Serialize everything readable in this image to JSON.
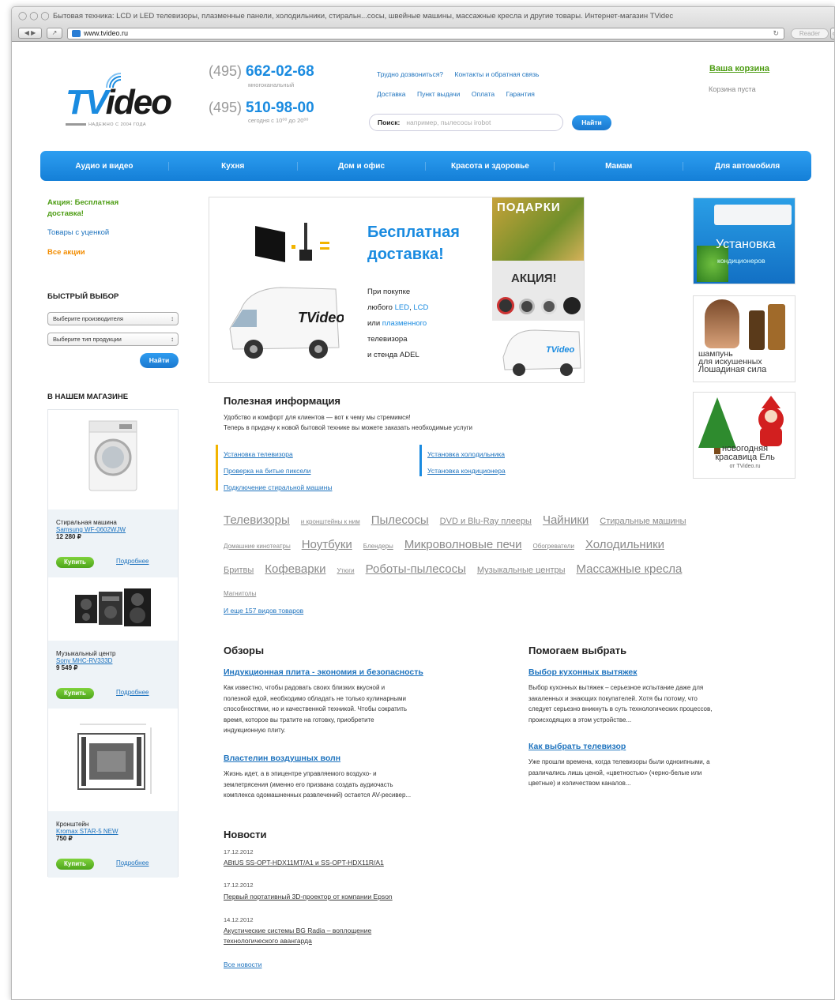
{
  "browser": {
    "window_title": "Бытовая техника: LCD и LED телевизоры, плазменные панели, холодильники, стиральн...сосы, швейные машины, массажные кресла и другие товары. Интернет-магазин TVidec",
    "url": "www.tvideo.ru",
    "reader_label": "Reader"
  },
  "header": {
    "logo_text_tv": "TV",
    "logo_text_ideo": "ideo",
    "logo_slogan": "НАДЕЖНО С 2004 ГОДА",
    "phone1_code": "(495)",
    "phone1_number": "662-02-68",
    "phone1_note": "многоканальный",
    "phone2_code": "(495)",
    "phone2_number": "510-98-00",
    "phone2_note": "сегодня с 10⁰⁰ до 20⁰⁰",
    "top_links_row1": [
      "Трудно дозвониться?",
      "Контакты и обратная связь"
    ],
    "top_links_row2": [
      "Доставка",
      "Пункт выдачи",
      "Оплата",
      "Гарантия"
    ],
    "search_label": "Поиск:",
    "search_placeholder": "например, пылесосы irobot",
    "search_button": "Найти",
    "cart_title": "Ваша корзина",
    "cart_status": "Корзина пуста"
  },
  "menu": [
    "Аудио и видео",
    "Кухня",
    "Дом и офис",
    "Красота и здоровье",
    "Мамам",
    "Для автомобиля"
  ],
  "left": {
    "promo_link": "Акция: Бесплатная доставка!",
    "discount_link": "Товары с уценкой",
    "all_promos_link": "Все акции",
    "quick_title": "БЫСТРЫЙ ВЫБОР",
    "select_maker": "Выберите производителя",
    "select_type": "Выберите тип продукции",
    "find_button": "Найти",
    "shop_title": "В НАШЕМ МАГАЗИНЕ",
    "products": [
      {
        "name": "Стиральная машина",
        "model": "Samsung WF-0602WJW",
        "price": "12 280 ₽",
        "buy": "Купить",
        "more": "Подробнее"
      },
      {
        "name": "Музыкальный центр",
        "model": "Sony MHC-RV333D",
        "price": "9 549 ₽",
        "buy": "Купить",
        "more": "Подробнее"
      },
      {
        "name": "Кронштейн",
        "model": "Kromax STAR-5 NEW",
        "price": "750 ₽",
        "buy": "Купить",
        "more": "Подробнее"
      }
    ]
  },
  "banner": {
    "title_line1": "Бесплатная",
    "title_line2": "доставка!",
    "desc": [
      "При покупке",
      "любого ",
      "LED",
      ", ",
      "LCD",
      "или ",
      "плазменного",
      "телевизора",
      "и стенда ADEL"
    ],
    "van_logo": "TVideo",
    "side_top": "ПОДАРКИ",
    "side_mid": "АКЦИЯ!",
    "van2_logo": "TVideo"
  },
  "useful": {
    "title": "Полезная информация",
    "text_line1": "Удобство и комфорт для клиентов — вот к чему мы стремимся!",
    "text_line2": "Теперь в придачу к новой бытовой технике вы можете заказать необходимые услуги",
    "links_left": [
      "Установка телевизора",
      "Проверка на битые пиксели",
      "Подключение стиральной машины"
    ],
    "links_right": [
      "Установка холодильника",
      "Установка кондиционера"
    ]
  },
  "tags": {
    "row1": [
      "Телевизоры",
      "и кронштейны к ним",
      "Пылесосы",
      "DVD и Blu-Ray плееры",
      "Чайники",
      "Стиральные машины"
    ],
    "row2": [
      "Домашние кинотеатры",
      "Ноутбуки",
      "Блендеры",
      "Микроволновые печи",
      "Обогреватели",
      "Холодильники"
    ],
    "row3": [
      "Бритвы",
      "Кофеварки",
      "Утюги",
      "Роботы-пылесосы",
      "Музыкальные центры",
      "Массажные кресла"
    ],
    "row4": [
      "Магнитолы"
    ],
    "more_link": "И еще 157 видов товаров"
  },
  "reviews": {
    "title": "Обзоры",
    "items": [
      {
        "title": "Индукционная плита - экономия и безопасность",
        "lines": [
          "Как известно, чтобы радовать своих близких вкусной и",
          "полезной едой, необходимо обладать не только кулинарными",
          "способностями, но и качественной техникой. Чтобы сократить",
          "время, которое вы тратите на готовку, приобретите",
          "индукционную плиту."
        ]
      },
      {
        "title": "Властелин воздушных волн",
        "lines": [
          "Жизнь идет, а в эпицентре управляемого воздухо- и",
          "землетрясения (именно его призвана создать аудиочасть",
          "комплекса одомашненных развлечений) остается AV-ресивер..."
        ]
      }
    ]
  },
  "help": {
    "title": "Помогаем выбрать",
    "items": [
      {
        "title": "Выбор кухонных вытяжек",
        "lines": [
          "Выбор кухонных вытяжек – серьезное испытание даже для",
          "закаленных и знающих покупателей. Хотя бы потому, что",
          "следует серьезно вникнуть в суть технологических процессов,",
          "происходящих в этом устройстве..."
        ]
      },
      {
        "title": "Как выбрать телевизор",
        "lines": [
          "Уже прошли времена, когда телевизоры были одноипными, а",
          "различались лишь ценой, «цветностью» (черно-белые или",
          "цветные) и количеством каналов..."
        ]
      }
    ]
  },
  "news": {
    "title": "Новости",
    "items": [
      {
        "date": "17.12.2012",
        "lines": [
          "ABtUS SS-OPT-HDX11MT/A1 и SS-OPT-HDX11R/A1"
        ]
      },
      {
        "date": "17.12.2012",
        "lines": [
          "Первый портативный 3D-проектор от компании Epson"
        ]
      },
      {
        "date": "14.12.2012",
        "lines": [
          "Акустические системы BG Radia – воплощение",
          "технологического авангарда"
        ]
      }
    ],
    "all_link": "Все новости"
  },
  "right_banners": {
    "ac_title": "Установка",
    "ac_sub": "кондиционеров",
    "shampoo_l1": "шампунь",
    "shampoo_l2": "для искушенных",
    "shampoo_l3": "Лошадиная сила",
    "tree_l1": "новогодняя",
    "tree_l2": "красавица Ель",
    "tree_l3": "от TVideo.ru"
  },
  "colors": {
    "accent": "#1a8be0",
    "menu_blue": "#1f8ee4",
    "green": "#4c9c12",
    "orange": "#f28c00"
  }
}
